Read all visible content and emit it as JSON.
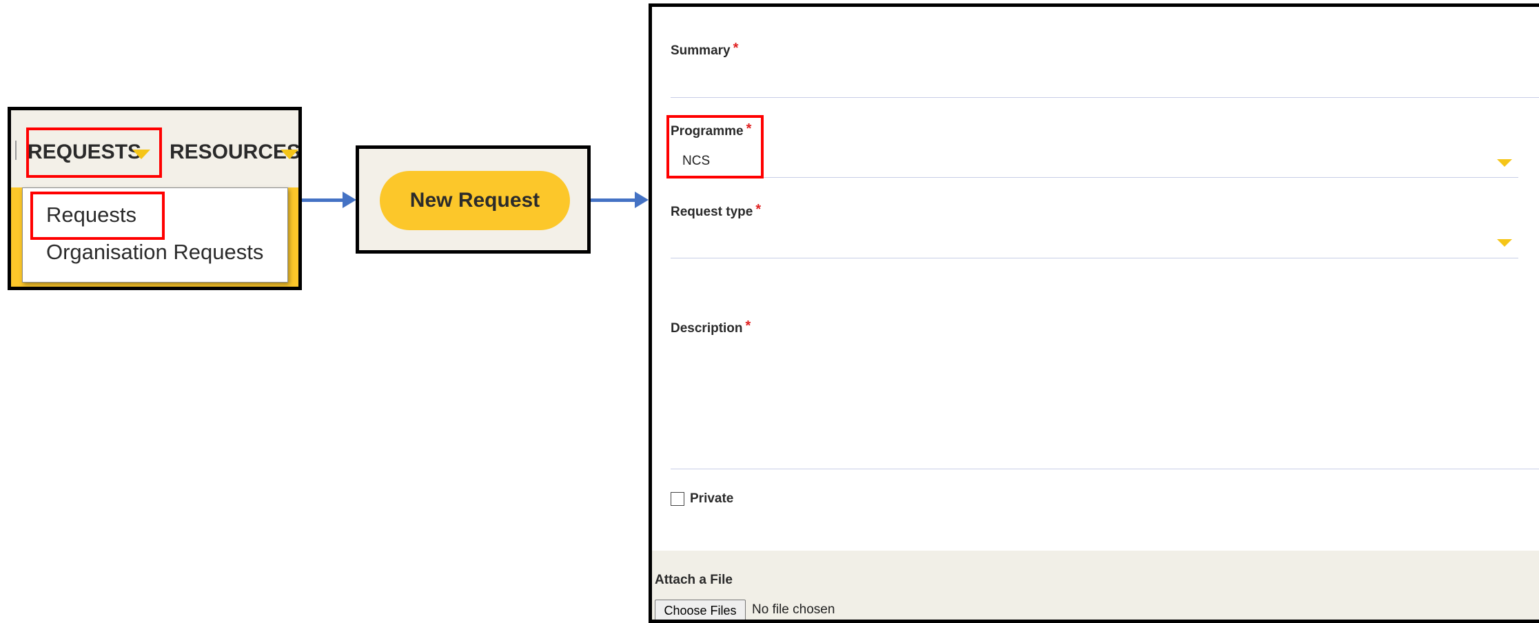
{
  "nav": {
    "tabs": [
      {
        "label": "REQUESTS",
        "icon": "caret-down-icon"
      },
      {
        "label": "RESOURCES",
        "icon": "caret-down-icon"
      }
    ],
    "dropdown_items": [
      "Requests",
      "Organisation Requests"
    ]
  },
  "new_request_button": {
    "label": "New Request"
  },
  "form": {
    "summary": {
      "label": "Summary",
      "required_mark": "*",
      "value": ""
    },
    "programme": {
      "label": "Programme",
      "required_mark": "*",
      "value": "NCS"
    },
    "request_type": {
      "label": "Request type",
      "required_mark": "*",
      "value": ""
    },
    "description": {
      "label": "Description",
      "required_mark": "*",
      "value": ""
    },
    "private": {
      "label": "Private",
      "checked": false
    },
    "attach": {
      "label": "Attach a File",
      "button_label": "Choose Files",
      "status": "No file chosen"
    }
  },
  "colors": {
    "accent_yellow": "#fcc72a",
    "panel_bg": "#f3f0e8",
    "highlight_red": "#ff0000",
    "arrow_blue": "#4472c4",
    "required_red": "#e02020"
  }
}
